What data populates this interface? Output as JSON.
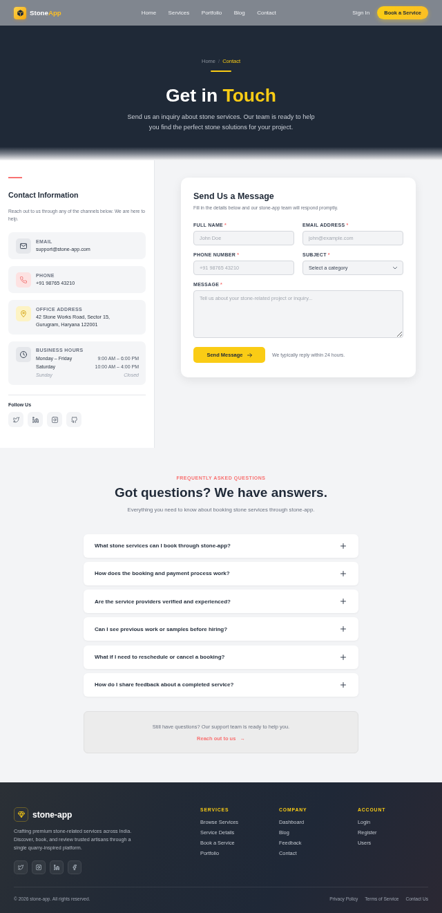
{
  "nav": {
    "brand": {
      "name": "Stone",
      "accent": "App"
    },
    "links": [
      {
        "label": "Home",
        "selected": false
      },
      {
        "label": "Services",
        "selected": false
      },
      {
        "label": "Portfolio",
        "selected": false
      },
      {
        "label": "Blog",
        "selected": false
      },
      {
        "label": "Contact",
        "selected": false
      }
    ],
    "sign_in": "Sign In",
    "cta": "Book a Service"
  },
  "hero": {
    "breadcrumb": [
      {
        "label": "Home",
        "current": false
      },
      {
        "label": "Contact",
        "current": true
      }
    ],
    "separator": "/",
    "title": "Get in",
    "title_accent": "Touch",
    "subtitle": "Send us an inquiry about stone services. Our team is ready to help you find the perfect stone solutions for your project."
  },
  "contact_info": {
    "title": "Contact Information",
    "description": "Reach out to us through any of the channels below. We are here to help.",
    "items": [
      {
        "kind": "email",
        "color": "#e5e7eb",
        "label": "EMAIL",
        "lines": [
          "support@stone-app.com"
        ]
      },
      {
        "kind": "phone",
        "color": "#fde2e2",
        "label": "PHONE",
        "lines": [
          "+91 98765 43210"
        ]
      },
      {
        "kind": "address",
        "color": "#fdf3c4",
        "label": "OFFICE ADDRESS",
        "lines": [
          "42 Stone Works Road, Sector 15,",
          "Gurugram, Haryana 122001"
        ]
      },
      {
        "kind": "hours",
        "color": "#e5e7eb",
        "label": "BUSINESS HOURS",
        "rows": [
          {
            "day": "Monday – Friday",
            "time": "9:00 AM – 6:00 PM",
            "closed": false
          },
          {
            "day": "Saturday",
            "time": "10:00 AM – 4:00 PM",
            "closed": false
          },
          {
            "day": "Sunday",
            "time": "Closed",
            "closed": true
          }
        ]
      }
    ],
    "follow": {
      "title": "Follow Us",
      "socials": [
        {
          "kind": "twitter"
        },
        {
          "kind": "linkedin"
        },
        {
          "kind": "instagram"
        },
        {
          "kind": "github"
        }
      ]
    }
  },
  "form": {
    "title": "Send Us a Message",
    "subtitle": "Fill in the details below and our stone-app team will respond promptly.",
    "required_mark": "*",
    "fields": [
      {
        "kind": "input",
        "label": "FULL NAME",
        "required": true,
        "placeholder": "John Doe"
      },
      {
        "kind": "input",
        "label": "EMAIL ADDRESS",
        "required": true,
        "placeholder": "john@example.com"
      },
      {
        "kind": "input",
        "label": "PHONE NUMBER",
        "required": true,
        "placeholder": "+91 98765 43210"
      },
      {
        "kind": "select",
        "label": "SUBJECT",
        "required": true,
        "value": "Select a category"
      },
      {
        "kind": "textarea",
        "label": "MESSAGE",
        "required": true,
        "placeholder": "Tell us about your stone-related project or inquiry..."
      }
    ],
    "submit": "Send Message",
    "note": "We typically reply within 24 hours."
  },
  "faq": {
    "overline": "FREQUENTLY ASKED QUESTIONS",
    "title": "Got questions? We have answers.",
    "subtitle": "Everything you need to know about booking stone services through stone-app.",
    "items": [
      {
        "question": "What stone services can I book through stone-app?",
        "expanded": false
      },
      {
        "question": "How does the booking and payment process work?",
        "expanded": false
      },
      {
        "question": "Are the service providers verified and experienced?",
        "expanded": false
      },
      {
        "question": "Can I see previous work or samples before hiring?",
        "expanded": false
      },
      {
        "question": "What if I need to reschedule or cancel a booking?",
        "expanded": false
      },
      {
        "question": "How do I share feedback about a completed service?",
        "expanded": false
      }
    ],
    "support": {
      "text": "Still have questions? Our support team is ready to help you.",
      "link": "Reach out to us",
      "arrow": "→"
    }
  },
  "footer": {
    "brand": "stone-app",
    "description": "Crafting premium stone-related services across India. Discover, book, and review trusted artisans through a single quarry-inspired platform.",
    "socials": [
      {
        "kind": "twitter"
      },
      {
        "kind": "instagram"
      },
      {
        "kind": "linkedin"
      },
      {
        "kind": "facebook"
      }
    ],
    "columns": [
      {
        "title": "SERVICES",
        "links": [
          "Browse Services",
          "Service Details",
          "Book a Service",
          "Portfolio"
        ]
      },
      {
        "title": "COMPANY",
        "links": [
          "Dashboard",
          "Blog",
          "Feedback",
          "Contact"
        ]
      },
      {
        "title": "ACCOUNT",
        "links": [
          "Login",
          "Register",
          "Users"
        ]
      }
    ],
    "copyright": "© 2026 stone-app. All rights reserved.",
    "legal": [
      "Privacy Policy",
      "Terms of Service",
      "Contact Us"
    ]
  }
}
